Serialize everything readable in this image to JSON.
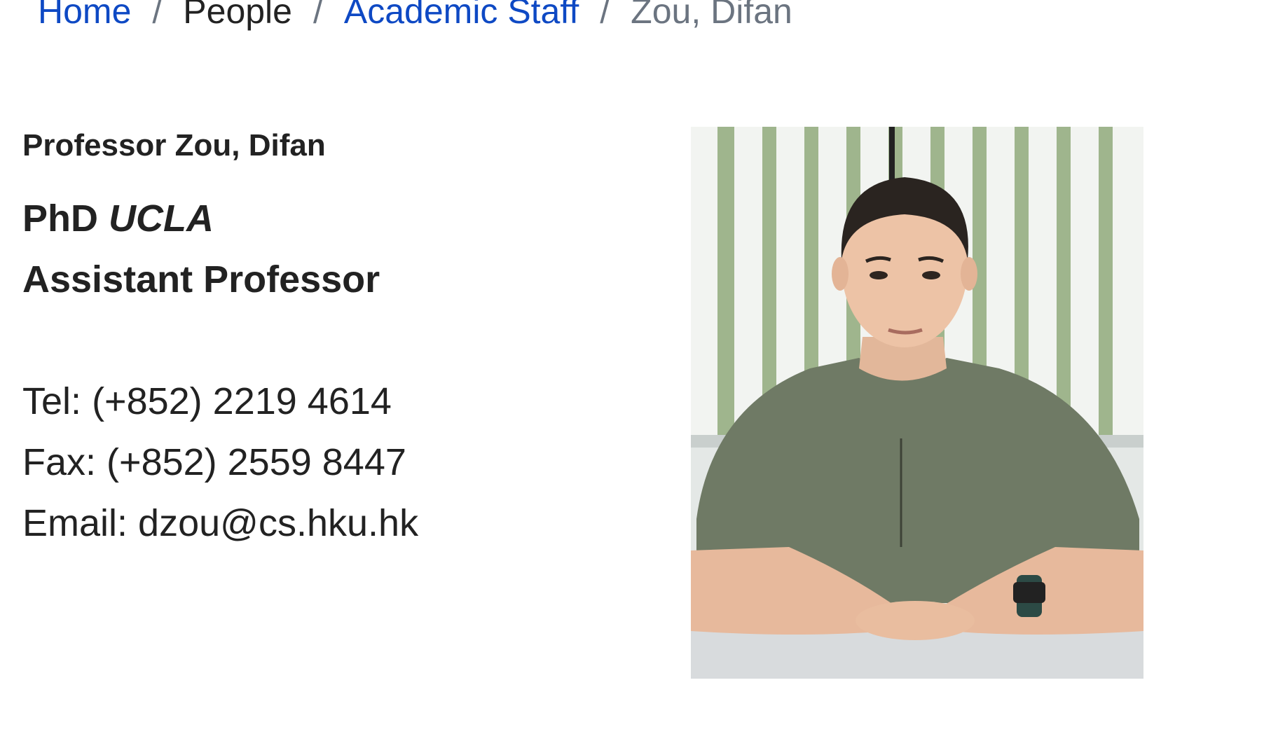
{
  "breadcrumb": {
    "home": "Home",
    "people": "People",
    "academic_staff": "Academic Staff",
    "current": "Zou, Difan",
    "separator": "/"
  },
  "profile": {
    "name": "Professor Zou, Difan",
    "degree": "PhD",
    "degree_institution": "UCLA",
    "position": "Assistant Professor"
  },
  "contact": {
    "tel_label": "Tel:",
    "tel": "(+852) 2219 4614",
    "fax_label": "Fax:",
    "fax": "(+852) 2559 8447",
    "email_label": "Email:",
    "email": "dzou@cs.hku.hk"
  },
  "colors": {
    "link": "#0e49c4",
    "text": "#222222",
    "muted": "#6b7480"
  }
}
